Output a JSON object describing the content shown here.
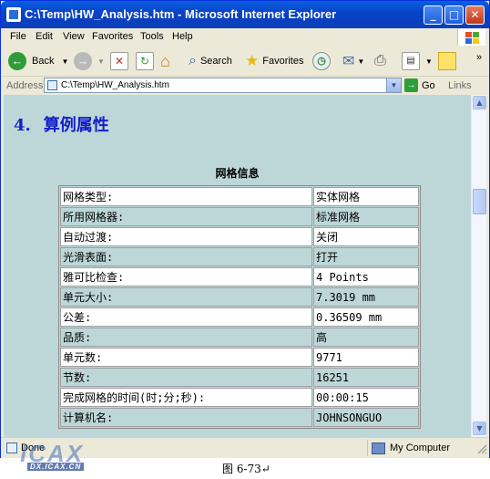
{
  "window": {
    "title": "C:\\Temp\\HW_Analysis.htm - Microsoft Internet Explorer",
    "min_glyph": "_",
    "max_glyph": "□",
    "close_glyph": "✕"
  },
  "menu": [
    "File",
    "Edit",
    "View",
    "Favorites",
    "Tools",
    "Help"
  ],
  "toolbar": {
    "back": "Back",
    "search": "Search",
    "favorites": "Favorites"
  },
  "address": {
    "label": "Address",
    "value": "C:\\Temp\\HW_Analysis.htm",
    "go": "Go",
    "links": "Links"
  },
  "page": {
    "heading_num": "4.",
    "heading_text": "算例属性",
    "table_caption": "网格信息",
    "rows": [
      {
        "key": "网格类型:",
        "value": "实体网格"
      },
      {
        "key": "所用网格器:",
        "value": "标准网格"
      },
      {
        "key": "自动过渡:",
        "value": "关闭"
      },
      {
        "key": "光滑表面:",
        "value": "打开"
      },
      {
        "key": "雅可比检查:",
        "value": "4 Points"
      },
      {
        "key": "单元大小:",
        "value": "7.3019 mm"
      },
      {
        "key": "公差:",
        "value": "0.36509 mm"
      },
      {
        "key": "品质:",
        "value": "高"
      },
      {
        "key": "单元数:",
        "value": "9771"
      },
      {
        "key": "节数:",
        "value": "16251"
      },
      {
        "key": "完成网格的时间(时;分;秒):",
        "value": "00:00:15"
      },
      {
        "key": "计算机名:",
        "value": "JOHNSONGUO"
      }
    ]
  },
  "status": {
    "text": "Done",
    "zone": "My Computer"
  },
  "watermark": {
    "logo": "ICAX",
    "sub": "DX.ICAX.CN"
  },
  "figure_caption": "图 6-73↵",
  "colors": {
    "content_bg": "#bdd7d8",
    "heading": "#1420c8",
    "titlebar": "#0842c8"
  }
}
